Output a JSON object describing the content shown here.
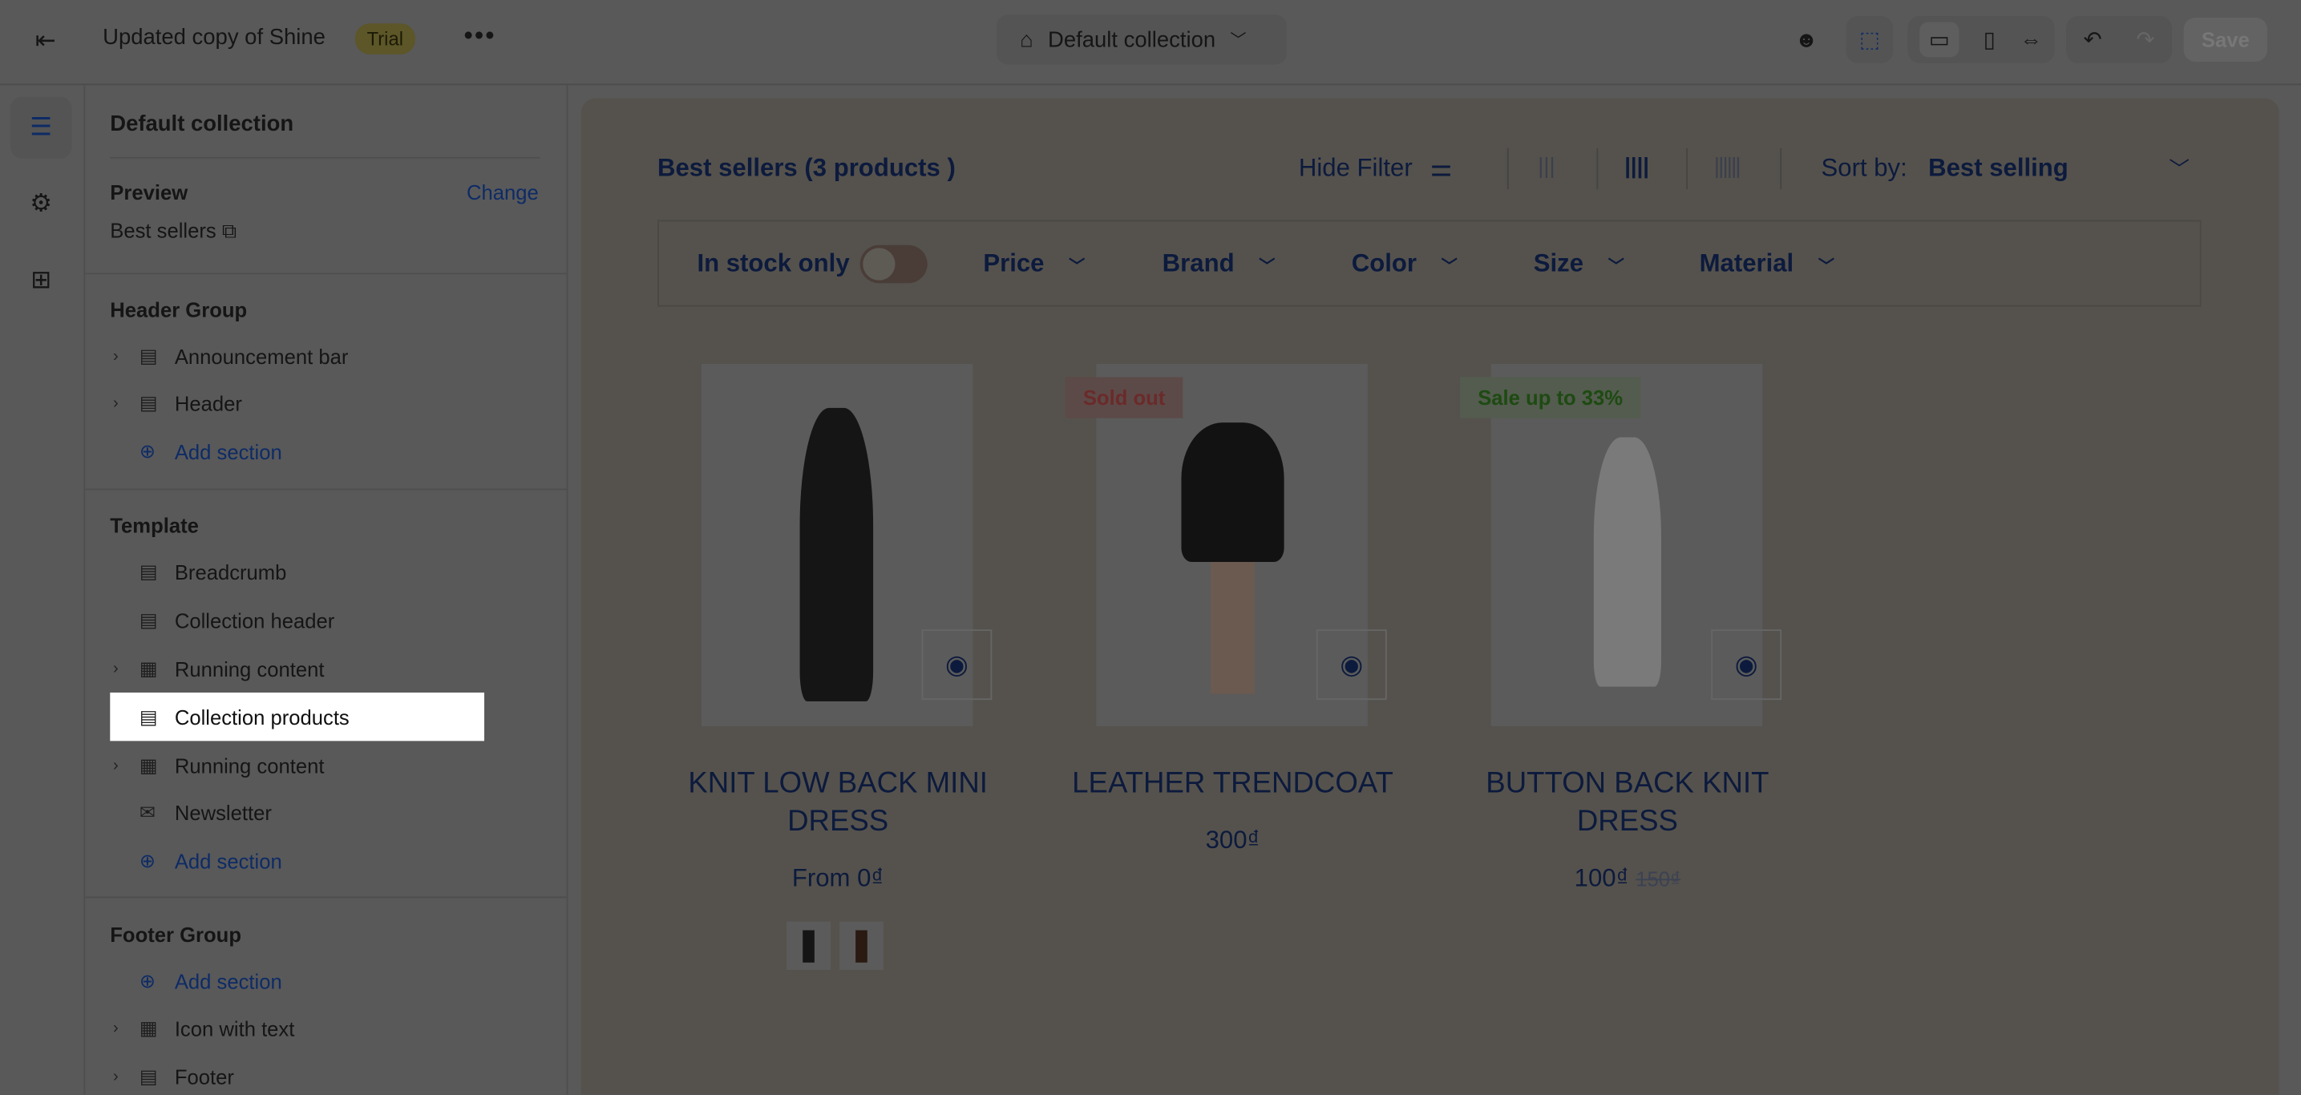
{
  "topbar": {
    "title": "Updated copy of Shine",
    "badge": "Trial",
    "more": "•••",
    "collection_selector": "Default collection",
    "save": "Save"
  },
  "sidebar": {
    "title": "Default collection",
    "preview_label": "Preview",
    "preview_change": "Change",
    "preview_value": "Best sellers",
    "groups": [
      {
        "label": "Header Group",
        "items": [
          "Announcement bar",
          "Header",
          "Add section"
        ]
      },
      {
        "label": "Template",
        "items": [
          "Breadcrumb",
          "Collection header",
          "Running content",
          "Collection products",
          "Running content",
          "Newsletter",
          "Add section"
        ]
      },
      {
        "label": "Footer Group",
        "items": [
          "Add section",
          "Icon with text",
          "Footer"
        ]
      }
    ]
  },
  "preview": {
    "heading": "Best sellers (3 products )",
    "hide_filter": "Hide Filter",
    "sort_label": "Sort by:",
    "sort_value": "Best selling",
    "filters": {
      "in_stock": "In stock only",
      "in_stock_on": false,
      "dropdowns": [
        "Price",
        "Brand",
        "Color",
        "Size",
        "Material"
      ]
    },
    "products": [
      {
        "name": "KNIT LOW BACK MINI DRESS",
        "price": "From 0₫",
        "badge": null
      },
      {
        "name": "LEATHER TRENDCOAT",
        "price": "300₫",
        "badge": "Sold out"
      },
      {
        "name": "BUTTON BACK KNIT DRESS",
        "price": "100₫",
        "compare_price": "150₫",
        "badge": "Sale up to 33%"
      }
    ]
  },
  "colors": {
    "accent": "#0e2b66",
    "sold_out": "#6b2a2a",
    "sale": "#1e4a12",
    "highlight": "#ffffff"
  }
}
